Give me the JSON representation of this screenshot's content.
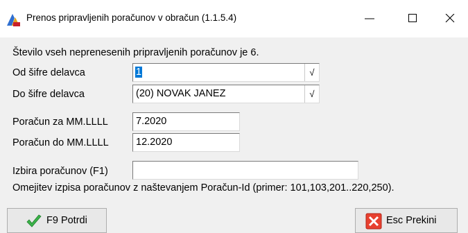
{
  "window": {
    "title": "Prenos pripravljenih poračunov v obračun  (1.1.5.4)",
    "icons": {
      "app": "app-logo-icon",
      "minimize": "minimize-icon",
      "maximize": "maximize-icon",
      "close": "close-icon"
    }
  },
  "info_text": "Število vseh neprenesenih pripravljenih poračunov je 6.",
  "form": {
    "od_sifre": {
      "label": "Od šifre delavca",
      "value": "1",
      "dropdown_glyph": "√"
    },
    "do_sifre": {
      "label": "Do šifre delavca",
      "value": "(20) NOVAK JANEZ",
      "dropdown_glyph": "√"
    },
    "poracun_za": {
      "label": "Poračun za MM.LLLL",
      "value": "7.2020"
    },
    "poracun_do": {
      "label": "Poračun do MM.LLLL",
      "value": "12.2020"
    },
    "izbira": {
      "label": "Izbira poračunov (F1)",
      "value": ""
    },
    "hint": "Omejitev izpisa poračunov z naštevanjem Poračun-Id (primer: 101,103,201..220,250)."
  },
  "buttons": {
    "confirm": {
      "label": "F9 Potrdi",
      "icon": "checkmark-icon"
    },
    "cancel": {
      "label": "Esc Prekini",
      "icon": "cancel-x-icon"
    }
  },
  "colors": {
    "selection": "#0078d7",
    "confirm_icon": "#3cb44a",
    "cancel_icon": "#e8402f"
  }
}
